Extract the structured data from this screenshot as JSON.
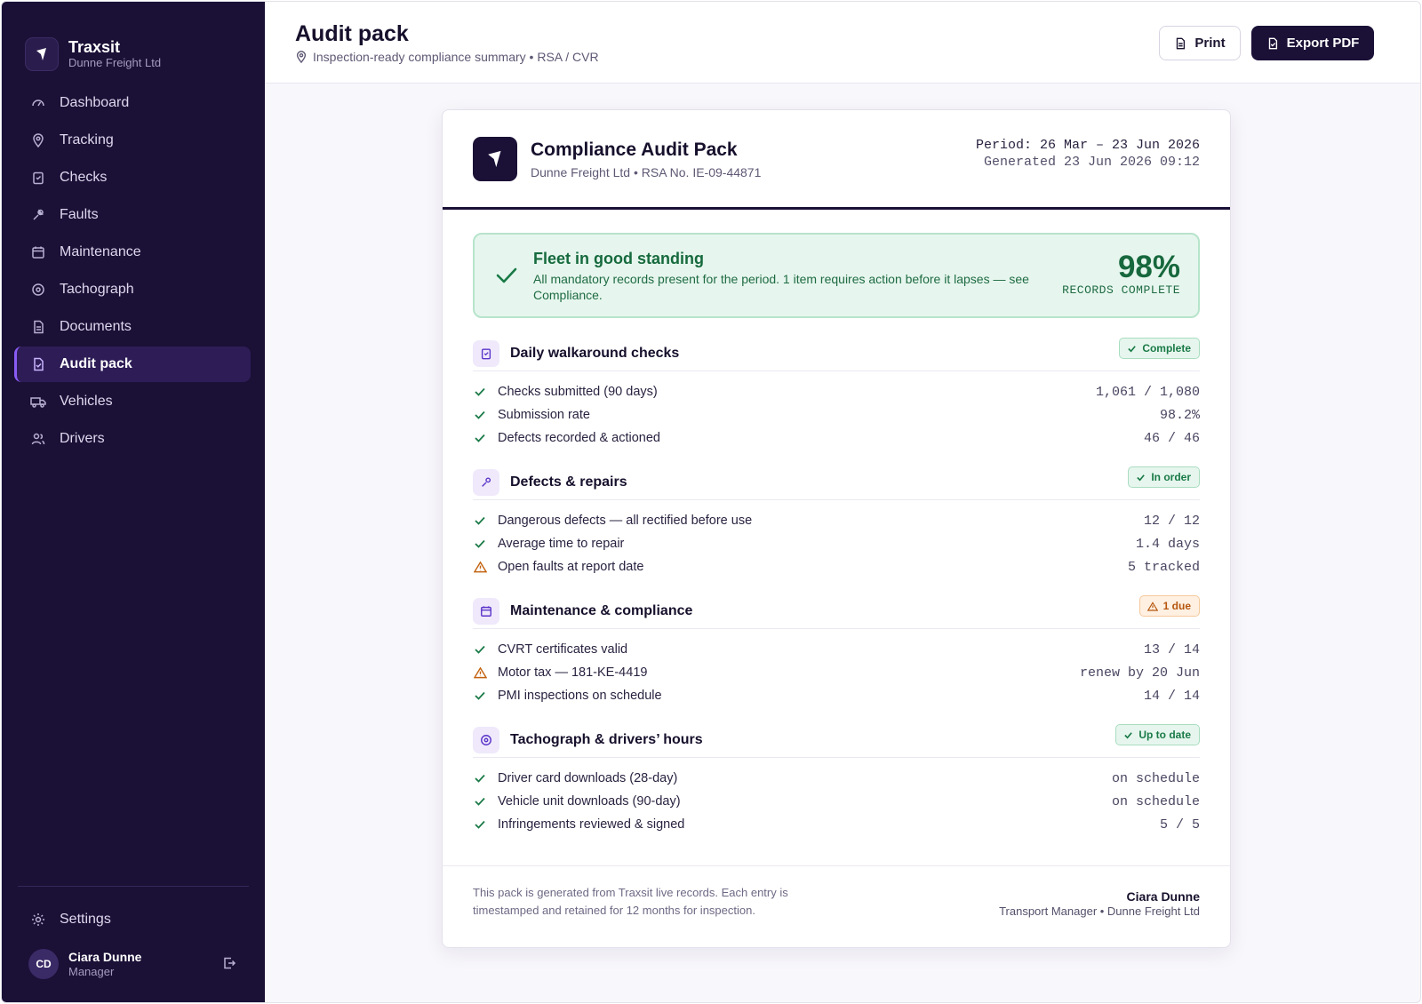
{
  "brand": {
    "name": "Traxsit",
    "company": "Dunne Freight Ltd"
  },
  "nav": [
    {
      "label": "Dashboard",
      "icon": "gauge-icon"
    },
    {
      "label": "Tracking",
      "icon": "map-pin-icon"
    },
    {
      "label": "Checks",
      "icon": "clipboard-check-icon"
    },
    {
      "label": "Faults",
      "icon": "wrench-icon"
    },
    {
      "label": "Maintenance",
      "icon": "calendar-icon"
    },
    {
      "label": "Tachograph",
      "icon": "target-icon"
    },
    {
      "label": "Documents",
      "icon": "document-icon"
    },
    {
      "label": "Audit pack",
      "icon": "file-check-icon",
      "active": true
    },
    {
      "label": "Vehicles",
      "icon": "truck-icon"
    },
    {
      "label": "Drivers",
      "icon": "users-icon"
    }
  ],
  "settings_label": "Settings",
  "user": {
    "initials": "CD",
    "name": "Ciara Dunne",
    "role": "Manager"
  },
  "header": {
    "title": "Audit pack",
    "subtitle": "Inspection-ready compliance summary • RSA / CVR",
    "print_label": "Print",
    "export_label": "Export PDF"
  },
  "pack": {
    "title": "Compliance Audit Pack",
    "subtitle": "Dunne Freight Ltd • RSA No. IE-09-44871",
    "period": "Period: 26 Mar – 23 Jun 2026",
    "generated": "Generated 23 Jun 2026 09:12"
  },
  "status": {
    "title": "Fleet in good standing",
    "description": "All mandatory records present for the period. 1 item requires action before it lapses — see Compliance.",
    "percent": "98%",
    "percent_label": "RECORDS COMPLETE"
  },
  "sections": [
    {
      "title": "Daily walkaround checks",
      "badge": "Complete",
      "rows": [
        {
          "label": "Checks submitted (90 days)",
          "value": "1,061 / 1,080",
          "status": "ok"
        },
        {
          "label": "Submission rate",
          "value": "98.2%",
          "status": "ok"
        },
        {
          "label": "Defects recorded & actioned",
          "value": "46 / 46",
          "status": "ok"
        }
      ]
    },
    {
      "title": "Defects & repairs",
      "badge": "In order",
      "rows": [
        {
          "label": "Dangerous defects — all rectified before use",
          "value": "12 / 12",
          "status": "ok"
        },
        {
          "label": "Average time to repair",
          "value": "1.4 days",
          "status": "ok"
        },
        {
          "label": "Open faults at report date",
          "value": "5 tracked",
          "status": "warn"
        }
      ]
    },
    {
      "title": "Maintenance & compliance",
      "badge": "1 due",
      "rows": [
        {
          "label": "CVRT certificates valid",
          "value": "13 / 14",
          "status": "ok"
        },
        {
          "label": "Motor tax — 181-KE-4419",
          "value": "renew by 20 Jun",
          "status": "warn"
        },
        {
          "label": "PMI inspections on schedule",
          "value": "14 / 14",
          "status": "ok"
        }
      ]
    },
    {
      "title": "Tachograph & drivers’ hours",
      "badge": "Up to date",
      "rows": [
        {
          "label": "Driver card downloads (28-day)",
          "value": "on schedule",
          "status": "ok"
        },
        {
          "label": "Vehicle unit downloads (90-day)",
          "value": "on schedule",
          "status": "ok"
        },
        {
          "label": "Infringements reviewed & signed",
          "value": "5 / 5",
          "status": "ok"
        }
      ]
    }
  ],
  "footer": {
    "note": "This pack is generated from Traxsit live records. Each entry is timestamped and retained for 12 months for inspection.",
    "signer_name": "Ciara Dunne",
    "signer_role": "Transport Manager • Dunne Freight Ltd"
  },
  "colors": {
    "sidebar": "#1b1036",
    "accent": "#8a5cf6",
    "ok": "#1a7a47",
    "warn": "#c2620f"
  }
}
